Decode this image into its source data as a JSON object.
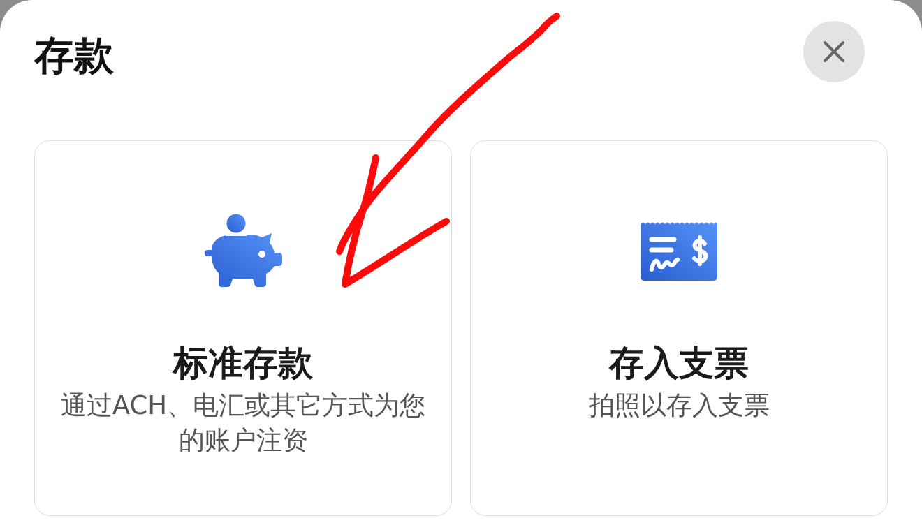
{
  "sheet": {
    "title": "存款"
  },
  "options": [
    {
      "title": "标准存款",
      "description": "通过ACH、电汇或其它方式为您的账户注资"
    },
    {
      "title": "存入支票",
      "description": "拍照以存入支票"
    }
  ],
  "annotations": [
    {
      "kind": "arrow"
    }
  ]
}
